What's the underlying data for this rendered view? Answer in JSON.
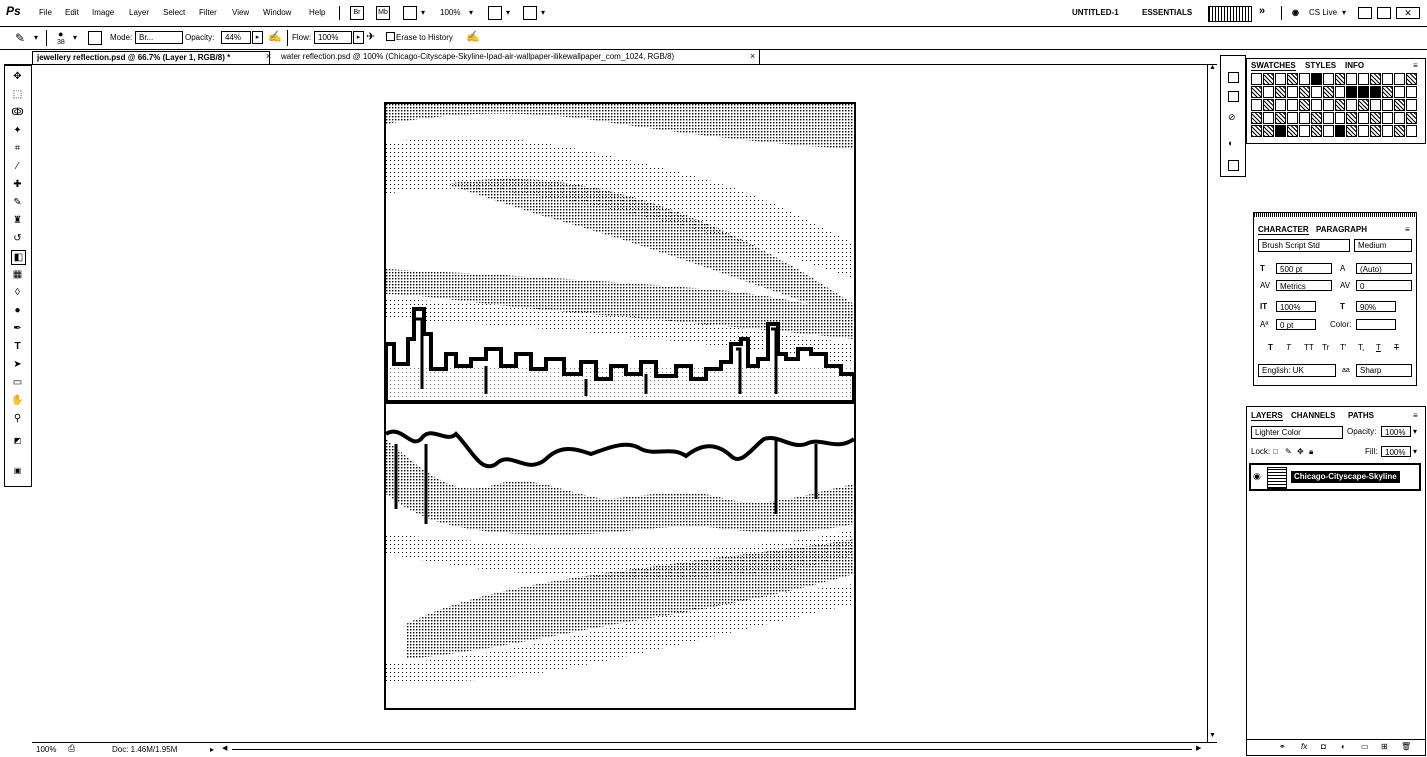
{
  "menubar": {
    "logo": "Ps",
    "items": [
      "File",
      "Edit",
      "Image",
      "Layer",
      "Select",
      "Filter",
      "View",
      "Window",
      "Help"
    ],
    "zoom": "100%",
    "workspace": "UNTITLED-1",
    "essentials": "ESSENTIALS",
    "cs_live": "CS Live"
  },
  "options": {
    "brush_size": "38",
    "mode_label": "Mode:",
    "mode_value": "Br...",
    "opacity_label": "Opacity:",
    "opacity_value": "44%",
    "flow_label": "Flow:",
    "flow_value": "100%",
    "erase_history": "Erase to History"
  },
  "tabs": [
    {
      "label": "jewellery reflection.psd @ 66.7% (Layer 1, RGB/8) *"
    },
    {
      "label": "water reflection.psd @ 100% (Chicago-Cityscape-Skyline-Ipad-air-wallpaper-ilikewallpaper_com_1024, RGB/8)"
    }
  ],
  "status": {
    "zoom": "100%",
    "doc": "Doc: 1.46M/1.95M"
  },
  "swatches_panel": {
    "tabs": [
      "SWATCHES",
      "STYLES",
      "INFO"
    ]
  },
  "character_panel": {
    "tabs": [
      "CHARACTER",
      "PARAGRAPH"
    ],
    "font_family": "Brush Script Std",
    "font_style": "Medium",
    "font_size": "500 pt",
    "leading": "(Auto)",
    "kerning": "Metrics",
    "tracking": "0",
    "vertical_scale": "100%",
    "horizontal_scale": "90%",
    "baseline_shift": "0 pt",
    "color_label": "Color:",
    "style_buttons": [
      "T",
      "T",
      "TT",
      "Tr",
      "T'",
      "T,",
      "T",
      "T"
    ],
    "language": "English: UK",
    "antialias_prefix": "aa",
    "antialias": "Sharp"
  },
  "layers_panel": {
    "tabs": [
      "LAYERS",
      "CHANNELS",
      "PATHS"
    ],
    "blend_mode": "Lighter Color",
    "opacity_label": "Opacity:",
    "opacity": "100%",
    "lock_label": "Lock:",
    "fill_label": "Fill:",
    "fill": "100%",
    "layer_name": "Chicago-Cityscape-Skyline"
  },
  "icons": {
    "tools": [
      "move-tool-icon",
      "marquee-tool-icon",
      "lasso-tool-icon",
      "quick-select-icon",
      "crop-tool-icon",
      "eyedropper-icon",
      "healing-brush-icon",
      "brush-tool-icon",
      "clone-stamp-icon",
      "history-brush-icon",
      "eraser-tool-icon",
      "gradient-tool-icon",
      "blur-tool-icon",
      "dodge-tool-icon",
      "pen-tool-icon",
      "type-tool-icon",
      "path-select-icon",
      "shape-tool-icon",
      "hand-tool-icon",
      "zoom-tool-icon"
    ]
  }
}
